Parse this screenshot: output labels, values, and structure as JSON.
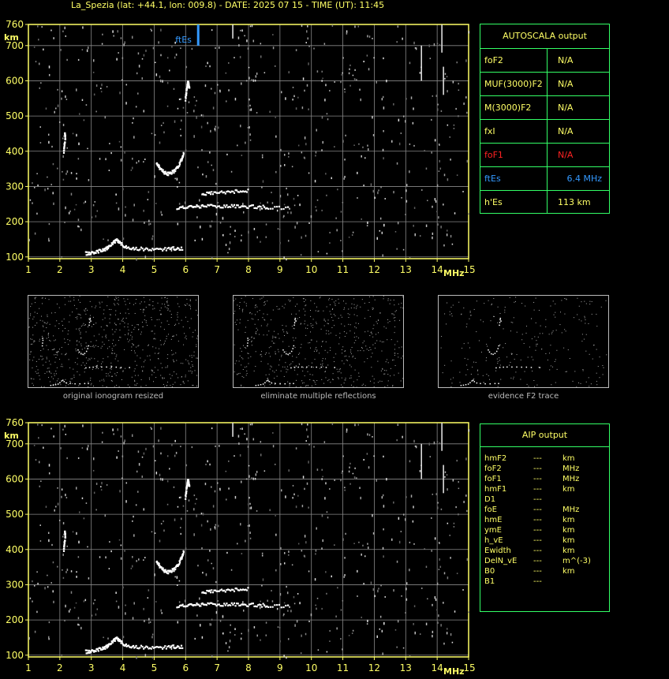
{
  "header": {
    "title": "La_Spezia (lat: +44.1, lon: 009.8) - DATE: 2025 07 15 - TIME (UT): 11:45"
  },
  "chart_data": [
    {
      "type": "scatter",
      "id": "ionogram-top",
      "xlabel": "MHz",
      "ylabel": "km",
      "xlim": [
        1,
        15
      ],
      "ylim": [
        95,
        760
      ],
      "x_ticks": [
        1,
        2,
        3,
        4,
        5,
        6,
        7,
        8,
        9,
        10,
        11,
        12,
        13,
        14,
        15
      ],
      "y_ticks": [
        100,
        200,
        300,
        400,
        500,
        600,
        700,
        760
      ],
      "grid": true,
      "annotation": {
        "label": "ftEs",
        "x": 6.4
      },
      "traces": [
        {
          "name": "E-layer",
          "points": [
            [
              2.8,
              112
            ],
            [
              3.0,
              114
            ],
            [
              3.2,
              118
            ],
            [
              3.4,
              122
            ],
            [
              3.55,
              132
            ],
            [
              3.7,
              145
            ],
            [
              3.8,
              150
            ],
            [
              3.9,
              140
            ],
            [
              4.1,
              130
            ],
            [
              4.4,
              126
            ],
            [
              4.8,
              124
            ],
            [
              5.2,
              124
            ],
            [
              5.6,
              126
            ],
            [
              5.9,
              126
            ]
          ]
        },
        {
          "name": "Es-layer",
          "points": [
            [
              5.7,
              240
            ],
            [
              6.0,
              243
            ],
            [
              6.3,
              245
            ],
            [
              6.6,
              246
            ],
            [
              7.0,
              246
            ],
            [
              7.4,
              246
            ],
            [
              7.8,
              245
            ],
            [
              8.2,
              245
            ],
            [
              8.6,
              243
            ],
            [
              9.3,
              242
            ]
          ]
        },
        {
          "name": "Es-multiple",
          "points": [
            [
              6.5,
              280
            ],
            [
              6.8,
              283
            ],
            [
              7.2,
              286
            ],
            [
              7.6,
              288
            ],
            [
              8.0,
              290
            ]
          ]
        },
        {
          "name": "F-trace",
          "points": [
            [
              5.05,
              370
            ],
            [
              5.15,
              355
            ],
            [
              5.3,
              342
            ],
            [
              5.45,
              338
            ],
            [
              5.6,
              345
            ],
            [
              5.75,
              360
            ],
            [
              5.85,
              380
            ],
            [
              5.92,
              400
            ]
          ]
        },
        {
          "name": "F-high",
          "points": [
            [
              5.97,
              550
            ],
            [
              6.0,
              570
            ],
            [
              6.03,
              590
            ],
            [
              6.05,
              600
            ],
            [
              6.1,
              580
            ]
          ]
        },
        {
          "name": "low-spike",
          "points": [
            [
              2.1,
              400
            ],
            [
              2.12,
              420
            ],
            [
              2.15,
              440
            ],
            [
              2.13,
              455
            ]
          ]
        }
      ]
    },
    {
      "type": "scatter",
      "id": "ionogram-bottom",
      "xlabel": "MHz",
      "ylabel": "km",
      "xlim": [
        1,
        15
      ],
      "ylim": [
        95,
        760
      ],
      "x_ticks": [
        1,
        2,
        3,
        4,
        5,
        6,
        7,
        8,
        9,
        10,
        11,
        12,
        13,
        14,
        15
      ],
      "y_ticks": [
        100,
        200,
        300,
        400,
        500,
        600,
        700,
        760
      ],
      "grid": true
    }
  ],
  "autoscala": {
    "title": "AUTOSCALA output",
    "rows": [
      {
        "key": "foF2",
        "value": "N/A",
        "color": "#ffff66"
      },
      {
        "key": "MUF(3000)F2",
        "value": "N/A",
        "color": "#ffff66"
      },
      {
        "key": "M(3000)F2",
        "value": "N/A",
        "color": "#ffff66"
      },
      {
        "key": "fxI",
        "value": "N/A",
        "color": "#ffff66"
      },
      {
        "key": "foF1",
        "value": "N/A",
        "color": "#ff2222"
      },
      {
        "key": "ftEs",
        "value": "6.4 MHz",
        "color": "#3399ff"
      },
      {
        "key": "h'Es",
        "value": "113     km",
        "color": "#ffff66"
      }
    ]
  },
  "thumbnails": [
    {
      "caption": "original ionogram resized"
    },
    {
      "caption": "eliminate multiple reflections"
    },
    {
      "caption": "evidence F2 trace"
    }
  ],
  "aip": {
    "title": "AIP output",
    "rows": [
      {
        "key": "hmF2",
        "value": "---",
        "unit": "km"
      },
      {
        "key": "foF2",
        "value": "---",
        "unit": "MHz"
      },
      {
        "key": "foF1",
        "value": "---",
        "unit": "MHz"
      },
      {
        "key": "hmF1",
        "value": "---",
        "unit": "km"
      },
      {
        "key": "D1",
        "value": "---",
        "unit": ""
      },
      {
        "key": "foE",
        "value": "---",
        "unit": "MHz"
      },
      {
        "key": "hmE",
        "value": "---",
        "unit": "km"
      },
      {
        "key": "ymE",
        "value": "---",
        "unit": "km"
      },
      {
        "key": "h_vE",
        "value": "---",
        "unit": "km"
      },
      {
        "key": "Ewidth",
        "value": "---",
        "unit": "km"
      },
      {
        "key": "DelN_vE",
        "value": "---",
        "unit": "m^(-3)"
      },
      {
        "key": "B0",
        "value": "---",
        "unit": "km"
      },
      {
        "key": "B1",
        "value": "---",
        "unit": ""
      }
    ]
  },
  "colors": {
    "axis": "#ffff66",
    "grid": "#888888",
    "panel_border": "#33ff66",
    "trace": "#ffffff",
    "ftEs_marker": "#3399ff"
  }
}
